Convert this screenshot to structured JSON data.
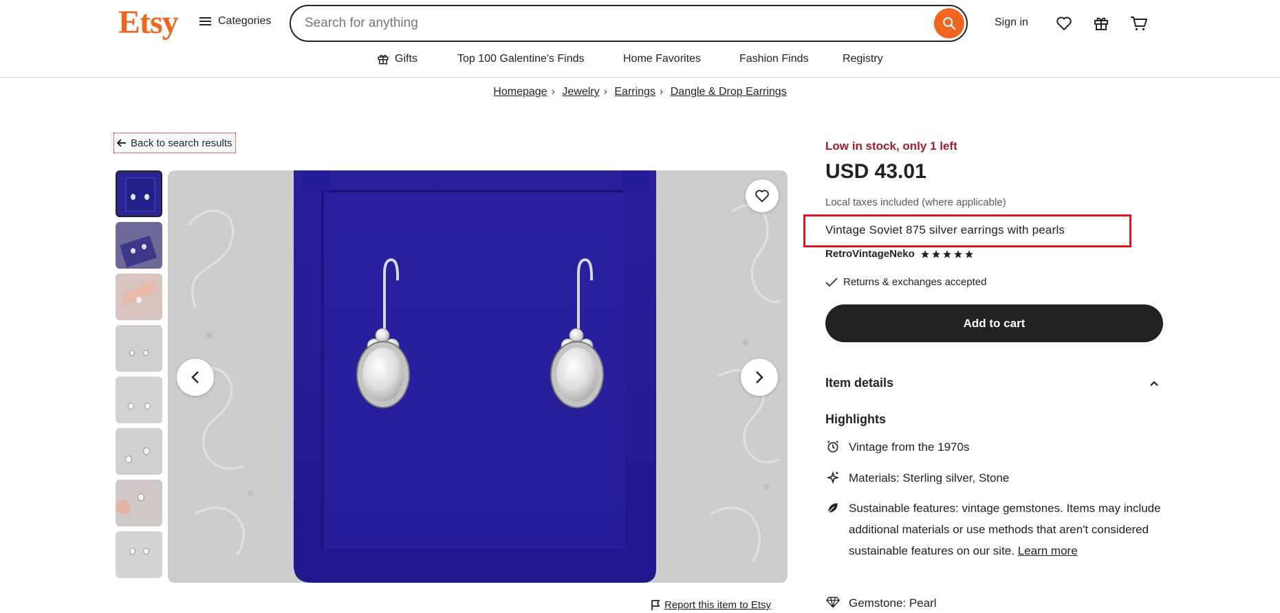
{
  "header": {
    "logo": "Etsy",
    "categories_label": "Categories",
    "search_placeholder": "Search for anything",
    "signin_label": "Sign in"
  },
  "nav": {
    "items": [
      {
        "label": "Gifts",
        "icon": "gift-icon"
      },
      {
        "label": "Top 100 Galentine's Finds"
      },
      {
        "label": "Home Favorites"
      },
      {
        "label": "Fashion Finds"
      },
      {
        "label": "Registry"
      }
    ]
  },
  "breadcrumb": [
    "Homepage",
    "Jewelry",
    "Earrings",
    "Dangle & Drop Earrings"
  ],
  "gallery": {
    "back_label": "Back to search results",
    "thumbnail_count": 8,
    "report_label": "Report this item to Etsy"
  },
  "product": {
    "stock": "Low in stock, only 1 left",
    "price": "USD 43.01",
    "taxes": "Local taxes included (where applicable)",
    "title": "Vintage Soviet 875 silver earrings with pearls",
    "shop": "RetroVintageNeko",
    "rating_stars": 5,
    "returns": "Returns & exchanges accepted",
    "add_to_cart": "Add to cart"
  },
  "details": {
    "header": "Item details",
    "highlights_title": "Highlights",
    "highlights": {
      "vintage": "Vintage from the 1970s",
      "materials": "Materials: Sterling silver, Stone",
      "sustainable": "Sustainable features: vintage gemstones. Items may include additional materials or use methods that aren't considered sustainable features on our site.",
      "learn_more": "Learn more",
      "gemstone": "Gemstone: Pearl"
    }
  },
  "colors": {
    "brand": "#F1641E",
    "stock": "#A61A2E",
    "highlight_box": "#E0141E",
    "button": "#222222"
  }
}
